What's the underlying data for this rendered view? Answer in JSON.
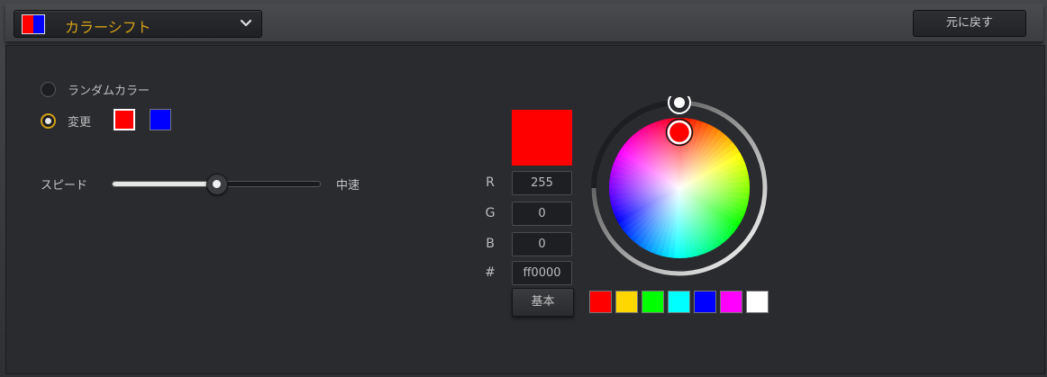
{
  "header": {
    "mode_label": "カラーシフト",
    "mode_swatch_colors": [
      "#ff0000",
      "#0000ff"
    ],
    "reset_label": "元に戻す"
  },
  "effect": {
    "random_label": "ランダムカラー",
    "change_label": "変更",
    "selected_option": "change",
    "change_colors": [
      "#ff0000",
      "#0000ff"
    ]
  },
  "speed": {
    "label": "スピード",
    "value_label": "中速",
    "level": 0.5
  },
  "picker": {
    "preview_color": "#ff0000",
    "r_label": "R",
    "g_label": "G",
    "b_label": "B",
    "hex_label": "#",
    "r": "255",
    "g": "0",
    "b": "0",
    "hex": "ff0000",
    "base_label": "基本",
    "presets": [
      "#ff0000",
      "#ffd700",
      "#00ff00",
      "#00ffff",
      "#0000ff",
      "#ff00ff",
      "#ffffff"
    ]
  },
  "colors": {
    "accent": "#d4a017",
    "background": "#2a2b2f"
  }
}
